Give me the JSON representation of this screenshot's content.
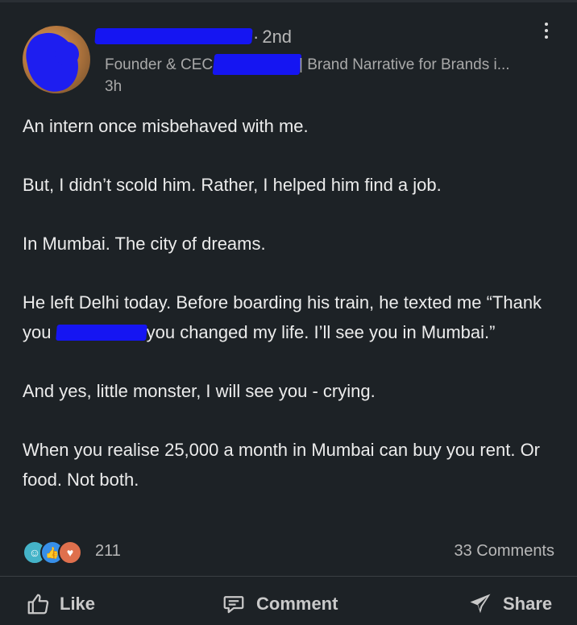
{
  "author": {
    "connection_degree": "2nd",
    "headline_prefix": "Founder & CEC",
    "headline_suffix": "| Brand Narrative for Brands i...",
    "time_ago": "3h"
  },
  "post": {
    "p1": "An intern once misbehaved with me.",
    "p2": "But, I didn’t scold him. Rather, I helped him find a job.",
    "p3": "In Mumbai. The city of dreams.",
    "p4_a": "He left Delhi today. Before boarding his train, he texted me “Thank you",
    "p4_b": "you changed my life. I’ll see you in Mumbai.”",
    "p5": "And yes, little monster, I will see you - crying.",
    "p6": "When you realise 25,000 a month in Mumbai can buy you rent. Or food. Not both."
  },
  "social": {
    "reaction_count": "211",
    "comments": "33 Comments"
  },
  "actions": {
    "like": "Like",
    "comment": "Comment",
    "share": "Share"
  },
  "colors": {
    "background": "#1d2226",
    "redaction": "#1515f2"
  }
}
